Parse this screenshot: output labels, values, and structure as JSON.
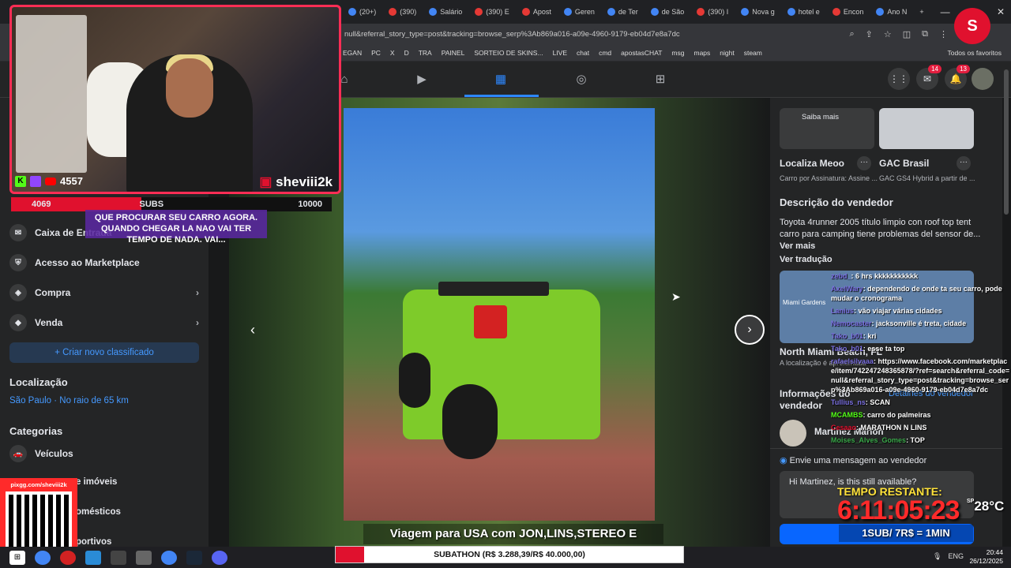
{
  "browser": {
    "tabs": [
      {
        "label": "(20+)"
      },
      {
        "label": "(390)"
      },
      {
        "label": "Salário"
      },
      {
        "label": "(390) E"
      },
      {
        "label": "Apost"
      },
      {
        "label": "Geren"
      },
      {
        "label": "de Ter"
      },
      {
        "label": "de São"
      },
      {
        "label": "(390) I"
      },
      {
        "label": "Nova g"
      },
      {
        "label": "hotel e"
      },
      {
        "label": "Encon"
      },
      {
        "label": "Ano N"
      }
    ],
    "new_tab": "+",
    "url": "null&referral_story_type=post&tracking=browse_serp%3Ab869a016-a09e-4960-9179-eb04d7e8a7dc",
    "bookmarks": [
      "EGAN",
      "PC",
      "X",
      "D",
      "TRA",
      "PAINEL",
      "SORTEIO DE SKINS...",
      "LIVE",
      "chat",
      "cmd",
      "apostasCHAT",
      "msg",
      "maps",
      "night",
      "steam"
    ],
    "bookmarks_folder": "Todos os favoritos",
    "window_controls": [
      "—",
      "▢",
      "✕"
    ]
  },
  "facebook": {
    "badges": {
      "messenger": "14",
      "notifications": "13"
    },
    "sidebar": {
      "items": [
        {
          "label": "Caixa de Entrada"
        },
        {
          "label": "Acesso ao Marketplace"
        },
        {
          "label": "Compra"
        },
        {
          "label": "Venda"
        }
      ],
      "create_button": "+ Criar novo classificado",
      "location_title": "Localização",
      "location_value": "São Paulo · No raio de 65 km",
      "categories_title": "Categorias",
      "categories": [
        {
          "label": "Veículos"
        },
        {
          "label": "e imóveis"
        },
        {
          "label": "omésticos"
        },
        {
          "label": "portivos"
        }
      ]
    },
    "right_panel": {
      "saiba_mais": "Saiba mais",
      "ad1_title": "Localiza Meoo",
      "ad1_sub": "Carro por Assinatura: Assine ...",
      "ad2_title": "GAC Brasil",
      "ad2_sub": "GAC GS4 Hybrid a partir de ...",
      "description_title": "Descrição do vendedor",
      "description": "Toyota 4runner 2005 título limpio con roof top tent carro para camping tiene problemas del sensor de...",
      "see_more": "Ver mais",
      "translate": "Ver tradução",
      "map_label": "Miami Gardens",
      "map_city": "North Miami Beach, FL",
      "map_note": "A localização é aproximada",
      "info_title": "Informações do vendedor",
      "seller_details": "Detalhes do vendedor",
      "seller_name": "Martinez Marlon",
      "message_label": "Envie uma mensagem ao vendedor",
      "message_text": "Hi Martinez, is this still available?"
    }
  },
  "stream": {
    "viewers": "4557",
    "handle": "sheviii2k",
    "subs_current": "4069",
    "subs_label": "SUBS",
    "subs_goal": "10000",
    "subs_progress": 0.4069,
    "chat_overlay": "QUE PROCURAR SEU CARRO AGORA. QUANDO CHEGAR LA NAO VAI TER TEMPO DE NADA. VAI...",
    "qr_label": "pixgg.com/sheviii2k",
    "chat": [
      {
        "user": "zebd_",
        "text": ": 6 hrs kkkkkkkkkkk"
      },
      {
        "user": "AxelWary",
        "text": ": dependendo de onde ta seu carro, pode mudar o cronograma"
      },
      {
        "user": "Lanius",
        "text": ": vão viajar várias cidades"
      },
      {
        "user": "Nemocaster",
        "text": ": jacksonville é treta, cidade"
      },
      {
        "user": "Tako_b01",
        "text": ": kri"
      },
      {
        "user": "Tako_b01",
        "text": ": esse ta top"
      },
      {
        "user": "rafaelsilvaaa",
        "text": ": https://www.facebook.com/marketplace/item/742247248365878/?ref=search&referral_code=null&referral_story_type=post&tracking=browse_serp%3Ab869a016-a09e-4960-9179-eb04d7e8a7dc"
      },
      {
        "user": "Tullius_ns",
        "text": ": SCAN"
      },
      {
        "user": "MCAMBS",
        "text": ": carro do palmeiras"
      },
      {
        "user": "Cesaao",
        "text": ": MARATHON N LINS"
      },
      {
        "user": "Moises_Alves_Gomes",
        "text": ": TOP"
      }
    ],
    "tempo_label": "TEMPO RESTANTE:",
    "timer": "6:11:05:23",
    "weather": "28°C",
    "weather_city": "SP",
    "sub_rate": "1SUB/ 7R$ = 1MIN",
    "caption": "Viagem para USA com JON,LINS,STEREO E MARCOVE",
    "subathon": "SUBATHON (R$ 3.288,39/R$ 40.000,00)",
    "subathon_progress": 0.0822
  },
  "taskbar": {
    "lang": "ENG",
    "time": "20:44",
    "date": "26/12/2025"
  },
  "colors": {
    "accent": "#2d88ff",
    "stream_red": "#e0112e",
    "timer_red": "#ff2a2a"
  }
}
